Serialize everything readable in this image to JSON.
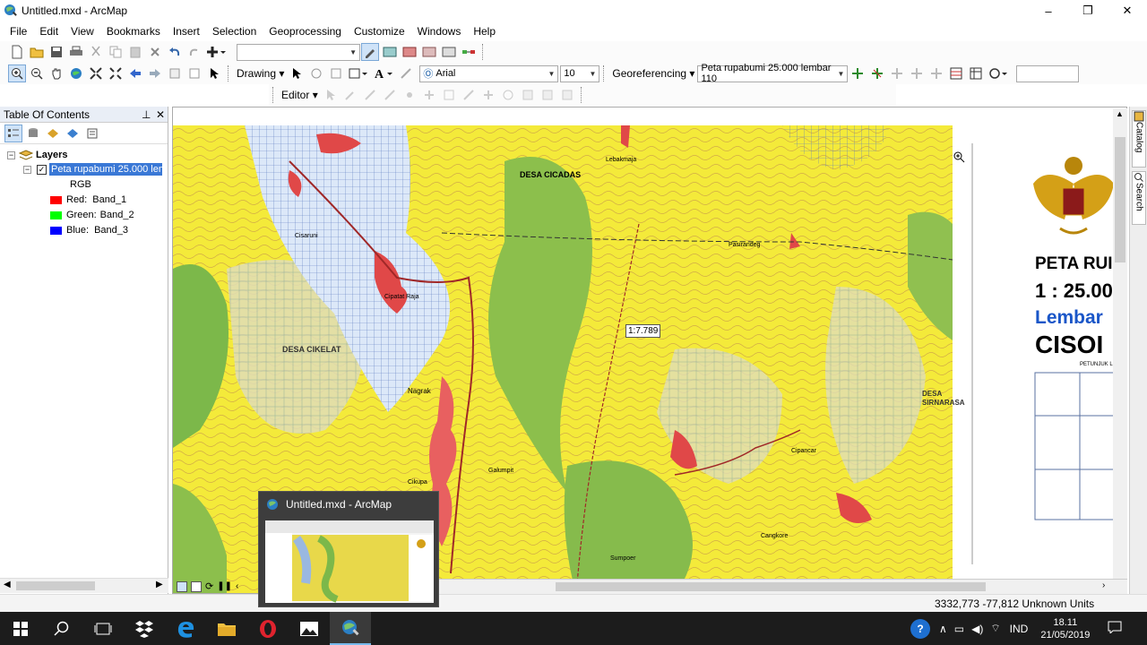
{
  "window": {
    "title": "Untitled.mxd - ArcMap",
    "minimize": "–",
    "maximize": "❐",
    "close": "✕"
  },
  "menu": [
    "File",
    "Edit",
    "View",
    "Bookmarks",
    "Insert",
    "Selection",
    "Geoprocessing",
    "Customize",
    "Windows",
    "Help"
  ],
  "toolbar": {
    "drawing_label": "Drawing",
    "font_name": "Arial",
    "font_size": "10",
    "georef_label": "Georeferencing",
    "georef_layer": "Peta rupabumi 25.000 lembar 110",
    "editor_label": "Editor"
  },
  "toc": {
    "title": "Table Of Contents",
    "group_label": "Layers",
    "layer_label": "Peta rupabumi 25.000 lem",
    "rgb_label": "RGB",
    "bands": [
      {
        "label": "Red:",
        "band": "Band_1",
        "color": "#ff0000"
      },
      {
        "label": "Green:",
        "band": "Band_2",
        "color": "#00ff00"
      },
      {
        "label": "Blue:",
        "band": "Band_3",
        "color": "#0000ff"
      }
    ]
  },
  "map": {
    "scale_tip": "1:7.789",
    "place_labels": [
      "DESA CICADAS",
      "DESA CIKELAT",
      "DESA SIRNARASA",
      "Nagrak",
      "Cipatat Raja",
      "Cisaruni",
      "Lebakmaja",
      "Pasirandeg",
      "Galumpit",
      "Cikupa",
      "Cipancar",
      "Sumpoer",
      "Cangkore"
    ],
    "sheet_title_lines": [
      "PETA RUI",
      "1 : 25.00",
      "Lembar",
      "CISOI"
    ],
    "legend_heading": "PETUNJUK LE"
  },
  "right_dock": [
    "Catalog",
    "Search"
  ],
  "status": {
    "coords": "3332,773  -77,812 Unknown Units"
  },
  "preview": {
    "title": "Untitled.mxd - ArcMap"
  },
  "taskbar": {
    "lang": "IND",
    "time": "18.11",
    "date": "21/05/2019"
  }
}
